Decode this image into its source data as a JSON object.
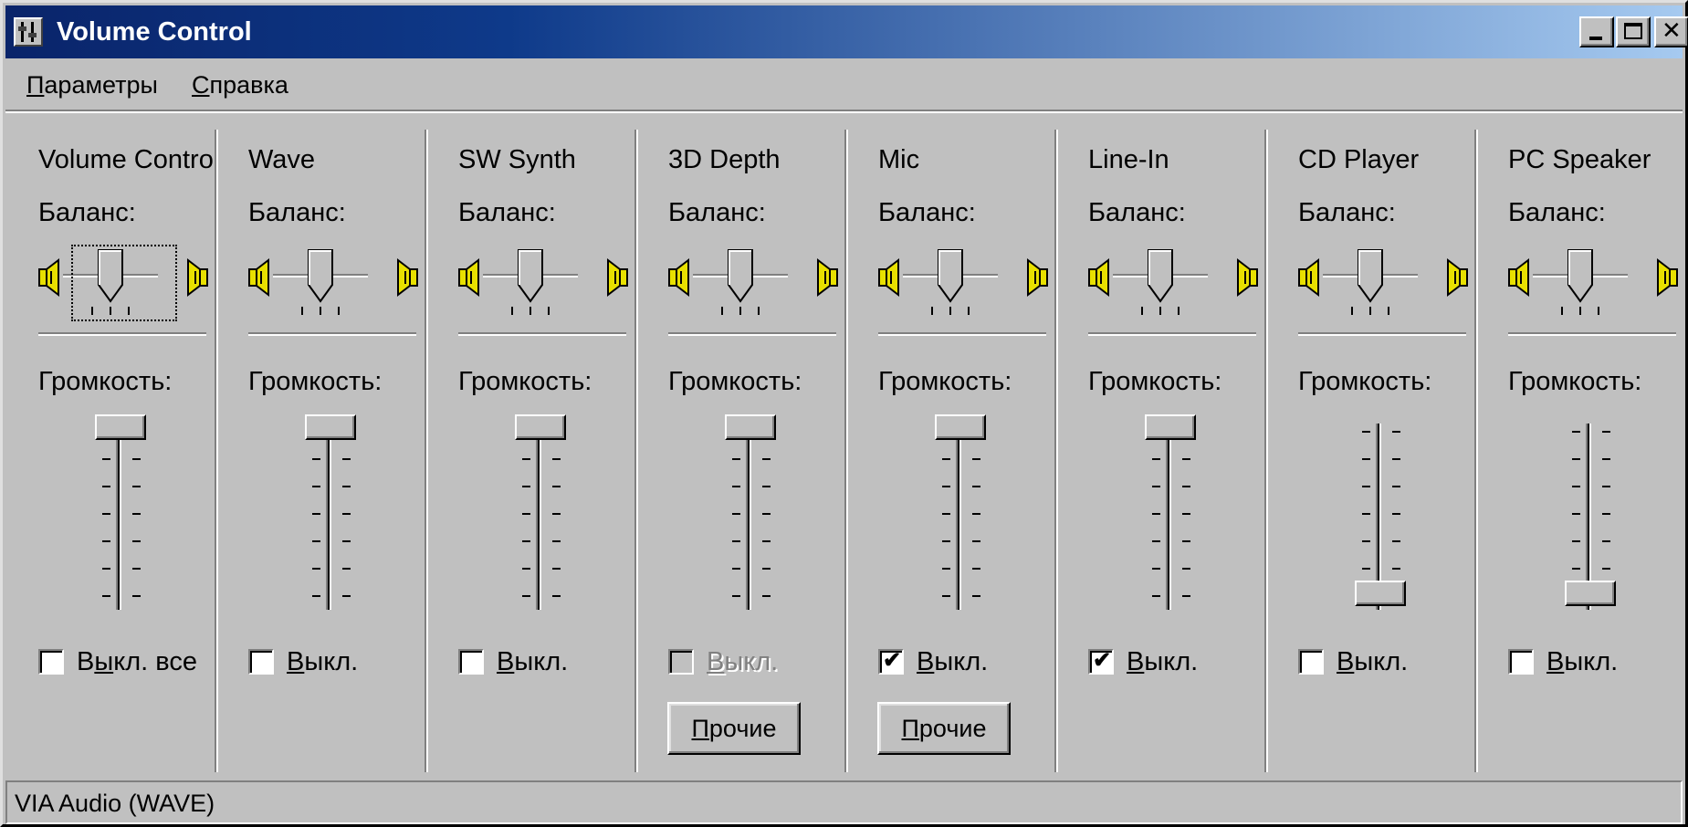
{
  "window": {
    "title": "Volume Control",
    "status_text": "VIA Audio (WAVE)"
  },
  "menu": [
    {
      "accel": "П",
      "rest": "араметры"
    },
    {
      "accel": "С",
      "rest": "правка"
    }
  ],
  "balance_label": "Баланс:",
  "volume_label": "Громкость:",
  "channels": [
    {
      "name": "Volume Control",
      "mute": {
        "pre": "В",
        "accel": "ы",
        "post": "кл. все"
      },
      "muted": false,
      "mute_enabled": true,
      "volume_level": 1.0,
      "focused": true,
      "advanced_label": null
    },
    {
      "name": "Wave",
      "mute": {
        "pre": "",
        "accel": "В",
        "post": "ыкл."
      },
      "muted": false,
      "mute_enabled": true,
      "volume_level": 1.0,
      "focused": false,
      "advanced_label": null
    },
    {
      "name": "SW Synth",
      "mute": {
        "pre": "",
        "accel": "В",
        "post": "ыкл."
      },
      "muted": false,
      "mute_enabled": true,
      "volume_level": 1.0,
      "focused": false,
      "advanced_label": null
    },
    {
      "name": "3D Depth",
      "mute": {
        "pre": "",
        "accel": "В",
        "post": "ыкл."
      },
      "muted": false,
      "mute_enabled": false,
      "volume_level": 1.0,
      "focused": false,
      "advanced_label": {
        "accel": "П",
        "rest": "рочие"
      }
    },
    {
      "name": "Mic",
      "mute": {
        "pre": "",
        "accel": "В",
        "post": "ыкл."
      },
      "muted": true,
      "mute_enabled": true,
      "volume_level": 1.0,
      "focused": false,
      "advanced_label": {
        "accel": "П",
        "rest": "рочие"
      }
    },
    {
      "name": "Line-In",
      "mute": {
        "pre": "",
        "accel": "В",
        "post": "ыкл."
      },
      "muted": true,
      "mute_enabled": true,
      "volume_level": 1.0,
      "focused": false,
      "advanced_label": null
    },
    {
      "name": "CD Player",
      "mute": {
        "pre": "",
        "accel": "В",
        "post": "ыкл."
      },
      "muted": false,
      "mute_enabled": true,
      "volume_level": 0.0,
      "focused": false,
      "advanced_label": null
    },
    {
      "name": "PC Speaker",
      "mute": {
        "pre": "",
        "accel": "В",
        "post": "ыкл."
      },
      "muted": false,
      "mute_enabled": true,
      "volume_level": 0.0,
      "focused": false,
      "advanced_label": null
    }
  ],
  "check_glyph": "✔",
  "colors": {
    "title_start": "#0a246a",
    "title_end": "#a6caf0",
    "face": "#c0c0c0",
    "speaker_yellow": "#e8e000"
  },
  "icons": [
    "mixer-app-icon",
    "minimize-icon",
    "maximize-icon",
    "close-icon",
    "speaker-left-icon",
    "speaker-right-icon"
  ]
}
